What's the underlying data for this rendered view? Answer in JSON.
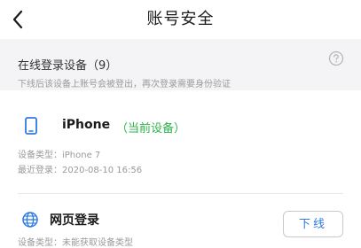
{
  "navbar": {
    "title": "账号安全",
    "back_icon": "chevron-left-icon"
  },
  "info": {
    "title": "在线登录设备（9）",
    "subtitle": "下线后该设备上账号会被登出，再次登录需要身份验证",
    "help_icon": "help-circle-icon"
  },
  "devices": [
    {
      "icon": "phone-icon",
      "name": "iPhone",
      "current_tag": "（当前设备）",
      "type_line": "设备类型：iPhone 7",
      "last_login_line": "最近登录：2020-08-10 16:56"
    },
    {
      "icon": "globe-icon",
      "name": "网页登录",
      "type_line": "设备类型：未能获取设备类型",
      "action_label": "下线"
    }
  ],
  "colors": {
    "accent_blue": "#2f7be0",
    "current_green": "#2eb24c",
    "background_gray": "#f4f4f6"
  }
}
